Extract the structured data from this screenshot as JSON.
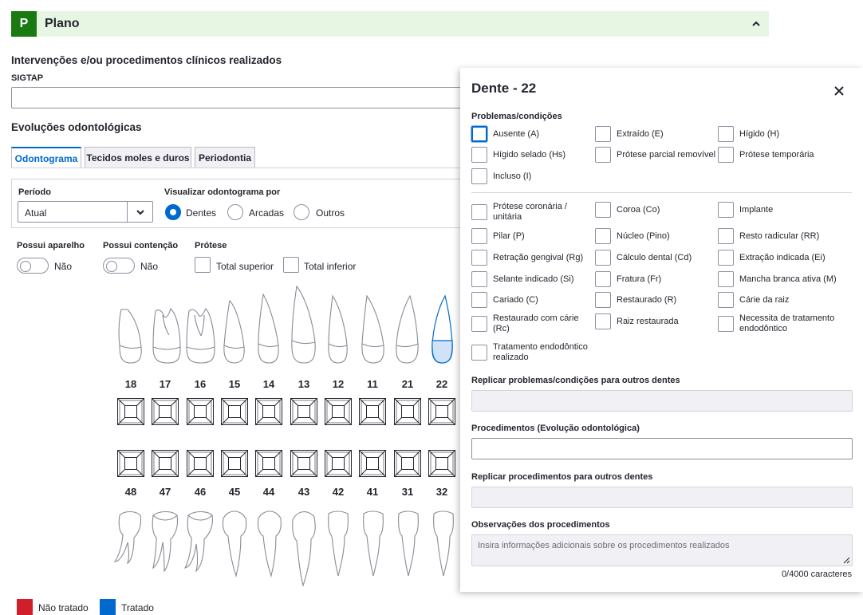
{
  "plano": {
    "badge": "P",
    "title": "Plano"
  },
  "interventions": {
    "title": "Intervenções e/ou procedimentos clínicos realizados",
    "sigtap_label": "SIGTAP"
  },
  "evolucoes": {
    "title": "Evoluções odontológicas"
  },
  "tabs": [
    {
      "label": "Odontograma",
      "active": true
    },
    {
      "label": "Tecidos moles e duros",
      "active": false
    },
    {
      "label": "Periodontia",
      "active": false
    }
  ],
  "filters": {
    "periodo_label": "Período",
    "periodo_value": "Atual",
    "visualizar_label": "Visualizar odontograma por",
    "visualizar_options": [
      "Dentes",
      "Arcadas",
      "Outros"
    ],
    "visualizar_selected": "Dentes"
  },
  "toggles": {
    "aparelho_label": "Possui aparelho",
    "aparelho_value": "Não",
    "contencao_label": "Possui contenção",
    "contencao_value": "Não"
  },
  "protese": {
    "label": "Prótese",
    "options": [
      "Total superior",
      "Total inferior"
    ]
  },
  "upper_teeth": [
    "18",
    "17",
    "16",
    "15",
    "14",
    "13",
    "12",
    "11",
    "21",
    "22"
  ],
  "lower_teeth": [
    "48",
    "47",
    "46",
    "45",
    "44",
    "43",
    "42",
    "41",
    "31",
    "32"
  ],
  "selected_tooth": "22",
  "legend": [
    {
      "label": "Não tratado",
      "color": "#d01f2a"
    },
    {
      "label": "Tratado",
      "color": "#0069d0"
    }
  ],
  "panel": {
    "title": "Dente - 22",
    "problemas_label": "Problemas/condições",
    "group1": [
      "Ausente (A)",
      "Extraído (E)",
      "Hígido (H)",
      "Hígido selado (Hs)",
      "Prótese parcial removível",
      "Prótese temporária",
      "Incluso (I)"
    ],
    "group2": [
      "Prótese coronária / unitária",
      "Coroa (Co)",
      "Implante",
      "Pilar (P)",
      "Núcleo (Pino)",
      "Resto radicular (RR)",
      "Retração gengival (Rg)",
      "Cálculo dental (Cd)",
      "Extração indicada (Ei)",
      "Selante indicado (Si)",
      "Fratura (Fr)",
      "Mancha branca ativa (M)",
      "Cariado (C)",
      "Restaurado (R)",
      "Cárie da raiz",
      "Restaurado com cárie (Rc)",
      "Raiz restaurada",
      "Necessita de tratamento endodôntico",
      "Tratamento endodôntico realizado"
    ],
    "replicar_problemas_label": "Replicar problemas/condições para outros dentes",
    "procedimentos_label": "Procedimentos (Evolução odontológica)",
    "replicar_procedimentos_label": "Replicar procedimentos para outros dentes",
    "observacoes_label": "Observações dos procedimentos",
    "observacoes_placeholder": "Insira informações adicionais sobre os procedimentos realizados",
    "char_count": "0/4000 caracteres"
  },
  "accent_color": "#0069d0",
  "brand_green": "#1a7a12"
}
